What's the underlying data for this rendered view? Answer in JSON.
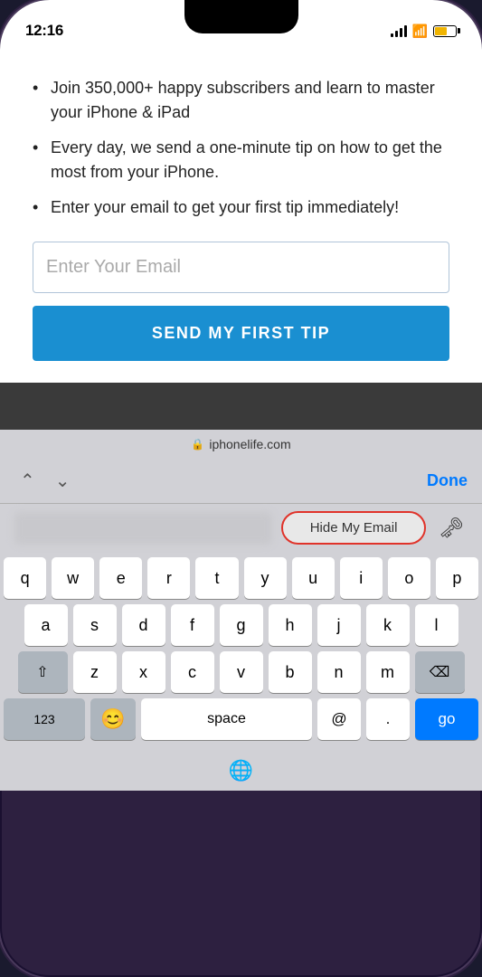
{
  "status_bar": {
    "time": "12:16",
    "domain": "iphonelife.com"
  },
  "web_content": {
    "bullets": [
      "Join 350,000+ happy subscribers and learn to master your iPhone & iPad",
      "Every day, we send a one-minute tip on how to get the most from your iPhone.",
      "Enter your email to get your first tip immediately!"
    ],
    "email_placeholder": "Enter Your Email",
    "submit_button_label": "SEND MY FIRST TIP"
  },
  "keyboard_toolbar": {
    "done_label": "Done"
  },
  "autocomplete": {
    "suggestion_label": "Hide My Email"
  },
  "keyboard": {
    "rows": [
      [
        "q",
        "w",
        "e",
        "r",
        "t",
        "y",
        "u",
        "i",
        "o",
        "p"
      ],
      [
        "a",
        "s",
        "d",
        "f",
        "g",
        "h",
        "j",
        "k",
        "l"
      ],
      [
        "⇧",
        "z",
        "x",
        "c",
        "v",
        "b",
        "n",
        "m",
        "⌫"
      ],
      [
        "123",
        "😊",
        "space",
        "@",
        ".",
        "go"
      ]
    ]
  }
}
